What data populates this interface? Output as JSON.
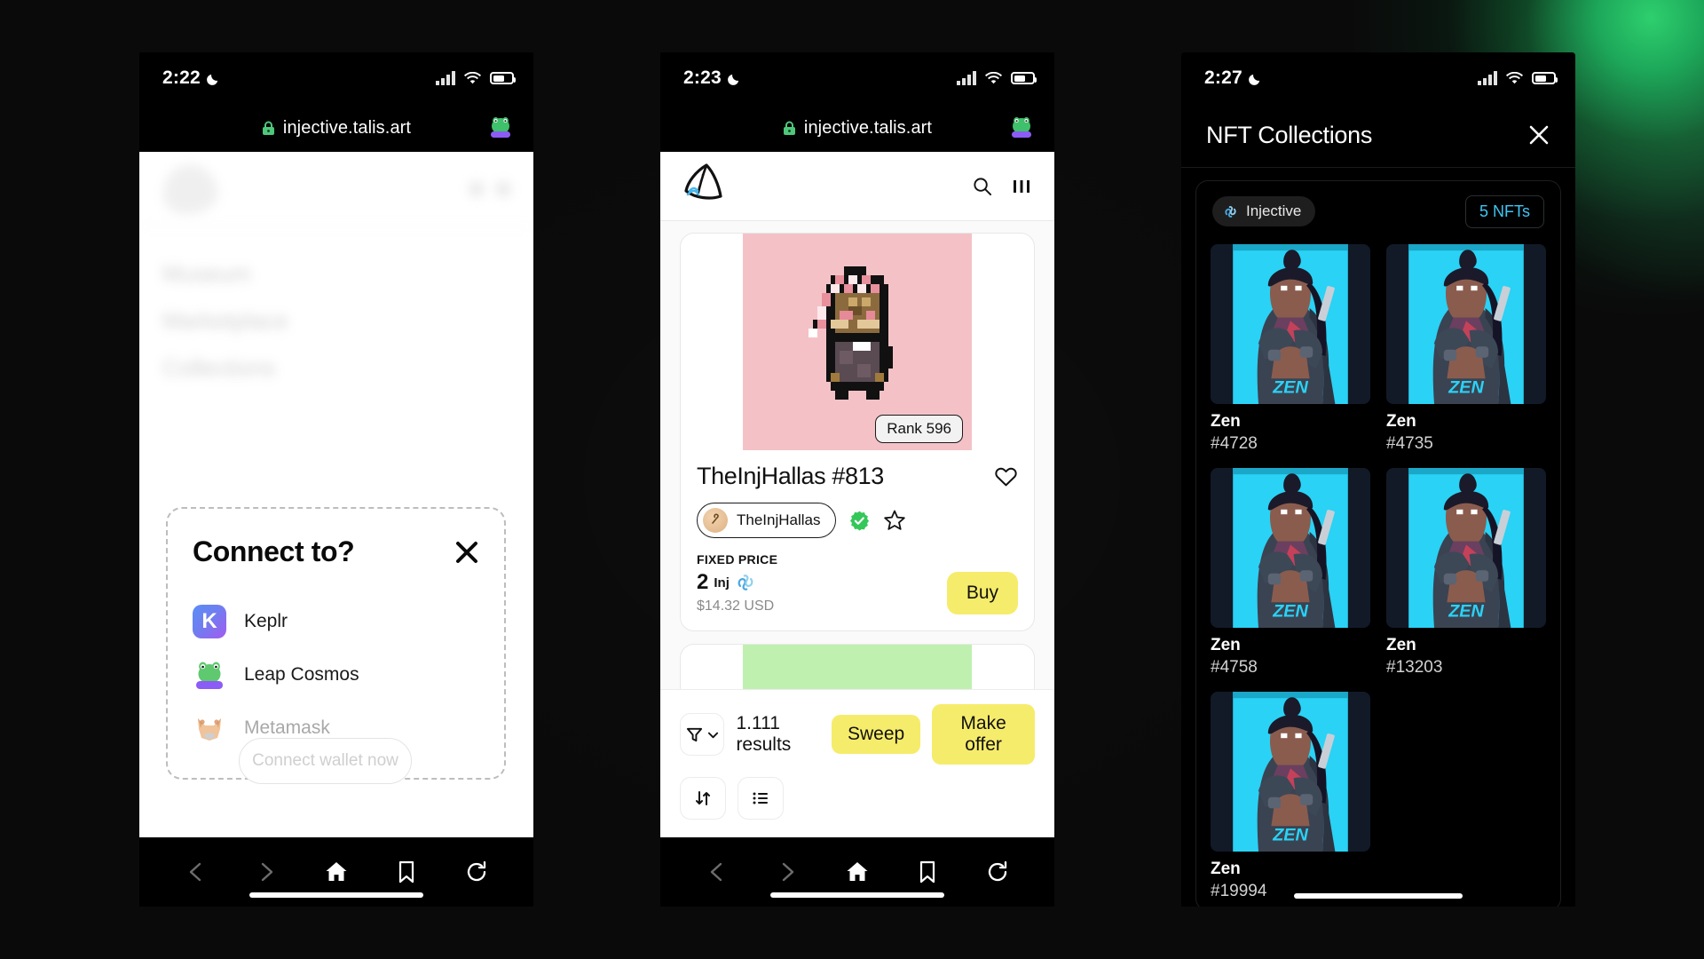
{
  "accent": {
    "yellow": "#f6ec6b",
    "green": "#3fb950",
    "cyan": "#3fc6f5",
    "pink_art_bg": "#f4c2c6",
    "green_art_bg": "#bff0b0"
  },
  "phone1": {
    "status": {
      "time": "2:22",
      "moon_icon": "crescent-moon-icon",
      "signal_icon": "signal-bars-icon",
      "wifi_icon": "wifi-icon",
      "battery_icon": "battery-icon"
    },
    "browser": {
      "url": "injective.talis.art",
      "lock_icon": "lock-icon",
      "extension_icon": "leap-wallet-extension-icon"
    },
    "site": {
      "logo_icon": "talis-logo-icon",
      "nav_items": [
        "Museum",
        "Marketplace",
        "Collections"
      ]
    },
    "modal": {
      "title": "Connect to?",
      "close_icon": "close-icon",
      "wallets": [
        {
          "name": "Keplr",
          "icon": "keplr-wallet-icon",
          "disabled": false
        },
        {
          "name": "Leap Cosmos",
          "icon": "leap-wallet-icon",
          "disabled": false
        },
        {
          "name": "Metamask",
          "icon": "metamask-wallet-icon",
          "disabled": true
        }
      ]
    },
    "connect_button": "Connect wallet now",
    "bottom_nav": [
      "back-icon",
      "forward-icon",
      "home-icon",
      "bookmark-icon",
      "reload-icon"
    ]
  },
  "phone2": {
    "status": {
      "time": "2:23",
      "moon_icon": "crescent-moon-icon"
    },
    "browser": {
      "url": "injective.talis.art",
      "lock_icon": "lock-icon",
      "extension_icon": "leap-wallet-extension-icon"
    },
    "header": {
      "logo_icon": "talis-logo-icon",
      "search_icon": "search-icon",
      "menu_icon": "grid-menu-icon"
    },
    "cards": [
      {
        "rank_badge": "Rank 596",
        "title": "TheInjHallas #813",
        "collection": "TheInjHallas",
        "verified": true,
        "favorite_icon": "heart-icon",
        "star_icon": "star-icon",
        "price_label": "FIXED PRICE",
        "price_amount": "2",
        "price_unit": "Inj",
        "price_usd": "$14.32 USD",
        "buy_label": "Buy",
        "art_bg": "#f4c2c6"
      },
      {
        "art_bg": "#bff0b0"
      }
    ],
    "dock": {
      "filter_icon": "filter-icon",
      "chevron_icon": "chevron-down-icon",
      "results": "1.111 results",
      "sweep_label": "Sweep",
      "make_offer_label": "Make offer",
      "sort_icon": "sort-arrows-icon",
      "list_icon": "list-view-icon"
    },
    "bottom_nav": [
      "back-icon",
      "forward-icon",
      "home-icon",
      "bookmark-icon",
      "reload-icon"
    ]
  },
  "phone3": {
    "status": {
      "time": "2:27",
      "moon_icon": "crescent-moon-icon"
    },
    "header": {
      "title": "NFT Collections",
      "close_icon": "close-icon"
    },
    "collection": {
      "chain": "Injective",
      "chain_icon": "injective-icon",
      "count_badge": "5 NFTs"
    },
    "nfts": [
      {
        "name": "Zen",
        "id": "#4728"
      },
      {
        "name": "Zen",
        "id": "#4735"
      },
      {
        "name": "Zen",
        "id": "#4758"
      },
      {
        "name": "Zen",
        "id": "#13203"
      },
      {
        "name": "Zen",
        "id": "#19994"
      }
    ]
  }
}
